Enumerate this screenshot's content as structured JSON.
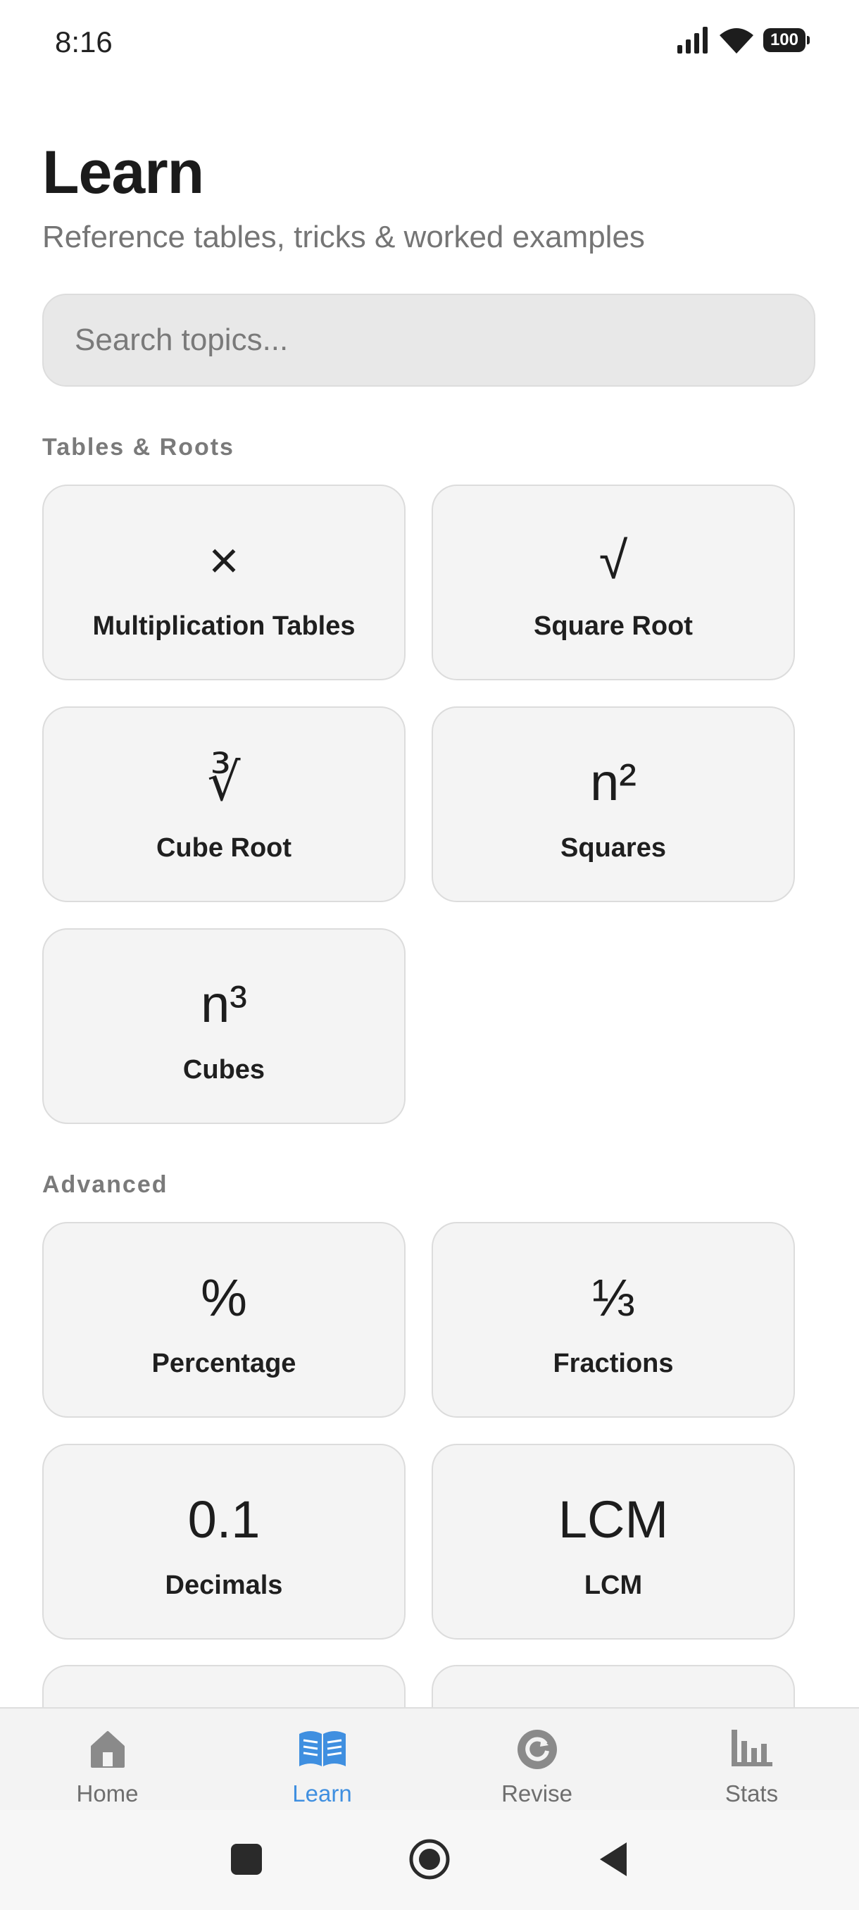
{
  "status_bar": {
    "time": "8:16",
    "battery": "100"
  },
  "header": {
    "title": "Learn",
    "subtitle": "Reference tables, tricks & worked examples"
  },
  "search": {
    "placeholder": "Search topics..."
  },
  "sections": {
    "tables_roots": {
      "label": "Tables & Roots",
      "items": [
        {
          "symbol": "×",
          "label": "Multiplication Tables"
        },
        {
          "symbol": "√",
          "label": "Square Root"
        },
        {
          "symbol": "∛",
          "label": "Cube Root"
        },
        {
          "symbol": "n²",
          "label": "Squares"
        },
        {
          "symbol": "n³",
          "label": "Cubes"
        }
      ]
    },
    "advanced": {
      "label": "Advanced",
      "items": [
        {
          "symbol": "%",
          "label": "Percentage"
        },
        {
          "symbol": "⅓",
          "label": "Fractions"
        },
        {
          "symbol": "0.1",
          "label": "Decimals"
        },
        {
          "symbol": "LCM",
          "label": "LCM"
        }
      ]
    }
  },
  "bottom_nav": {
    "active_color": "#3f8fe0",
    "inactive_color": "#8a8a8a",
    "tabs": [
      {
        "label": "Home",
        "icon": "home-icon"
      },
      {
        "label": "Learn",
        "icon": "book-icon",
        "active": true
      },
      {
        "label": "Revise",
        "icon": "refresh-icon"
      },
      {
        "label": "Stats",
        "icon": "bar-chart-icon"
      }
    ]
  }
}
